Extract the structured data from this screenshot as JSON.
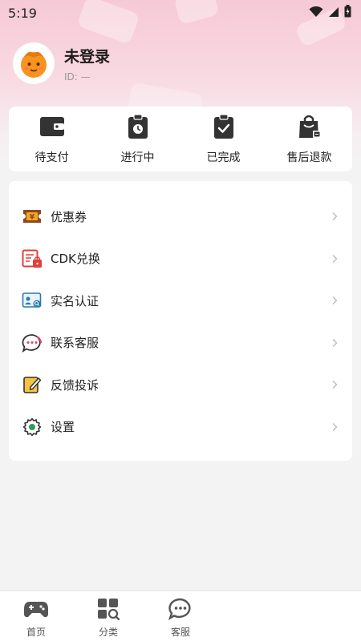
{
  "status_bar": {
    "time": "5:19"
  },
  "profile": {
    "name": "未登录",
    "id_text": "ID: —"
  },
  "orders": [
    {
      "label": "待支付",
      "icon": "wallet-icon"
    },
    {
      "label": "进行中",
      "icon": "clipboard-clock-icon"
    },
    {
      "label": "已完成",
      "icon": "clipboard-check-icon"
    },
    {
      "label": "售后退款",
      "icon": "shopping-bag-refund-icon"
    }
  ],
  "menu": [
    {
      "label": "优惠券",
      "icon": "coupon-icon"
    },
    {
      "label": "CDK兑换",
      "icon": "cdk-redeem-icon"
    },
    {
      "label": "实名认证",
      "icon": "id-verify-icon"
    },
    {
      "label": "联系客服",
      "icon": "chat-bubble-icon"
    },
    {
      "label": "反馈投诉",
      "icon": "feedback-edit-icon"
    },
    {
      "label": "设置",
      "icon": "gear-icon"
    }
  ],
  "nav": [
    {
      "label": "首页",
      "icon": "gamepad-icon"
    },
    {
      "label": "分类",
      "icon": "category-grid-icon"
    },
    {
      "label": "客服",
      "icon": "chat-icon"
    }
  ],
  "colors": {
    "hero_pink": "#f6c9d6",
    "avatar_orange": "#f7931e",
    "coupon_brown": "#8b4a1f",
    "cdk_red": "#e0403c",
    "chat_pink": "#e73e6b",
    "feedback_yellow": "#f5c342",
    "gear_green": "#2e9d5b"
  }
}
